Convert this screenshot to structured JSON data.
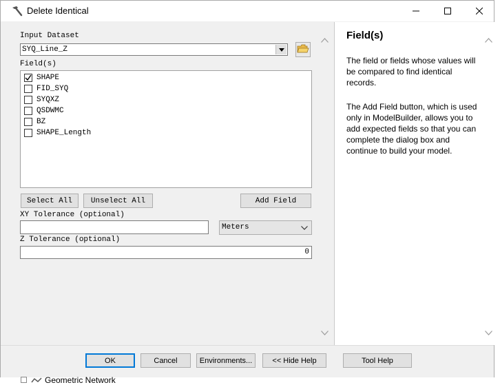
{
  "window": {
    "title": "Delete Identical",
    "icon": "hammer-icon"
  },
  "form": {
    "input_dataset_label": "Input Dataset",
    "input_dataset_value": "SYQ_Line_Z",
    "fields_label": "Field(s)",
    "fields": [
      {
        "name": "SHAPE",
        "checked": true
      },
      {
        "name": "FID_SYQ",
        "checked": false
      },
      {
        "name": "SYQXZ",
        "checked": false
      },
      {
        "name": "QSDWMC",
        "checked": false
      },
      {
        "name": "BZ",
        "checked": false
      },
      {
        "name": "SHAPE_Length",
        "checked": false
      }
    ],
    "select_all": "Select All",
    "unselect_all": "Unselect All",
    "add_field": "Add Field",
    "xy_tolerance_label": "XY Tolerance (optional)",
    "xy_tolerance_value": "",
    "xy_units": "Meters",
    "z_tolerance_label": "Z Tolerance (optional)",
    "z_tolerance_value": "0"
  },
  "help": {
    "title": "Field(s)",
    "paragraph1": "The field or fields whose values will be compared to find identical records.",
    "paragraph2": "The Add Field button, which is used only in ModelBuilder, allows you to add expected fields so that you can complete the dialog box and continue to build your model."
  },
  "buttons": {
    "ok": "OK",
    "cancel": "Cancel",
    "environments": "Environments...",
    "hide_help": "<< Hide Help",
    "tool_help": "Tool Help"
  },
  "background": {
    "tree_item": "Geometric Network"
  }
}
